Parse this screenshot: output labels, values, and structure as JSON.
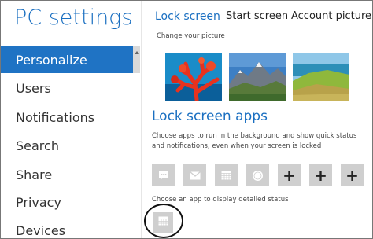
{
  "app": {
    "title": "PC settings"
  },
  "sidebar": {
    "items": [
      {
        "label": "Personalize",
        "selected": true
      },
      {
        "label": "Users"
      },
      {
        "label": "Notifications"
      },
      {
        "label": "Search"
      },
      {
        "label": "Share"
      },
      {
        "label": "Privacy"
      },
      {
        "label": "Devices"
      }
    ]
  },
  "tabs": [
    {
      "label": "Lock screen",
      "active": true
    },
    {
      "label": "Start screen"
    },
    {
      "label": "Account picture"
    }
  ],
  "picture": {
    "caption": "Change your picture"
  },
  "lock_apps": {
    "title": "Lock screen apps",
    "description": "Choose apps to run in the background and show quick status and notifications, even when  your screen is locked",
    "slots": [
      {
        "icon": "messaging-icon"
      },
      {
        "icon": "mail-icon"
      },
      {
        "icon": "calendar-icon"
      },
      {
        "icon": "weather-icon"
      },
      {
        "icon": "plus-icon",
        "label": "+"
      },
      {
        "icon": "plus-icon",
        "label": "+"
      },
      {
        "icon": "plus-icon",
        "label": "+"
      }
    ],
    "detail_caption": "Choose an app to display detailed status",
    "detail_slot": {
      "icon": "calendar-icon"
    }
  },
  "colors": {
    "accent": "#1f73c4",
    "tile": "#cfcfcf"
  }
}
